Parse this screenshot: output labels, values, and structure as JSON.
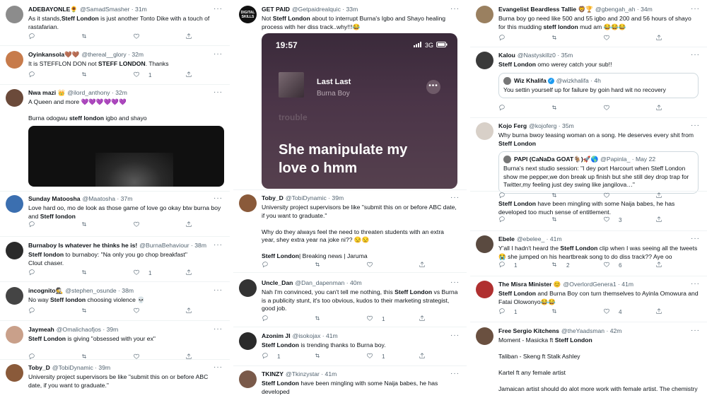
{
  "col1": [
    {
      "name": "ADEBAYONLE🌻",
      "handle": "@SamadSmasher · 31m",
      "text_html": "As it stands,<b>Steff London</b> is just another Tonto Dike with a touch of rastafarian.",
      "counts": {
        "reply": "",
        "rt": "",
        "like": ""
      },
      "avatar_color": "#8c8c8c"
    },
    {
      "name": "Oyinkansola🤎🤎",
      "handle": "@thereal__glory · 32m",
      "text_html": "It is STEFFLON DON not <b>STEFF LONDON</b>. Thanks",
      "counts": {
        "reply": "",
        "rt": "",
        "like": "1"
      },
      "avatar_color": "#c77b4b"
    },
    {
      "name": "Nwa mazi 👑",
      "handle": "@ilord_anthony · 32m",
      "text_html": "A Queen and more 💜💜💜💜💜💜\n\nBurna odogwu <b>steff london</b> igbo and shayo",
      "avatar_color": "#6b4a3a"
    },
    {
      "name": "Sunday Matoosha",
      "handle": "@Maatosha · 37m",
      "text_html": "Love hard oo, mo de look as those game of love go okay btw burna boy and <b>Steff london</b>",
      "counts": {
        "reply": "",
        "rt": "",
        "like": ""
      },
      "avatar_color": "#3b6fb0"
    },
    {
      "name": "Burnaboy Is whatever he thinks he is!",
      "handle": "@BurnaBehaviour · 38m",
      "text_html": "<b>Steff london</b> to burnaboy: \"Na only you go chop breakfast\"\nClout chaser.",
      "counts": {
        "reply": "",
        "rt": "",
        "like": "1"
      },
      "avatar_color": "#2b2b2b"
    },
    {
      "name": "incognito🕵",
      "handle": "@stephen_osunde · 38m",
      "text_html": "No way <b>Steff london</b> choosing violence 💀",
      "counts": {
        "reply": "",
        "rt": "",
        "like": ""
      },
      "avatar_color": "#444"
    },
    {
      "name": "Jaymeah",
      "handle": "@Omalichaofjos · 39m",
      "text_html": "<b>Steff London</b> is giving \"obsessed with your ex\"",
      "counts": {
        "reply": "",
        "rt": "",
        "like": ""
      },
      "avatar_color": "#c9a08a"
    },
    {
      "name": "Toby_D",
      "handle": "@TobiDynamic · 39m",
      "text_html": "University project supervisors be like \"submit this on or before ABC date, if you want to graduate.\"",
      "avatar_color": "#8a5a3a"
    }
  ],
  "col2": [
    {
      "name": "GET PAID",
      "handle": "@Getpaidrealquic · 33m",
      "text_html": "Not <b>Steff London</b> about to interrupt Burna's Igbo and Shayo healing process with her diss track..why!!!😂",
      "avatar_color": "#111",
      "avatar_text": "DIGITAL SKILLS"
    },
    {
      "name": "Toby_D",
      "handle": "@TobiDynamic · 39m",
      "text_html": "University project supervisors be like \"submit this on or before ABC date, if you want to graduate.\"\n\nWhy do they always feel the need to threaten students with an extra year, shey extra year na joke ni?? 😒😒\n\n<b>Steff London</b>| Breaking news | Jaruma",
      "counts": {
        "reply": "",
        "rt": "",
        "like": ""
      },
      "avatar_color": "#8a5a3a"
    },
    {
      "name": "Uncle_Dan",
      "handle": "@Dan_dapenman · 40m",
      "text_html": "Nah I'm convinced, you can't tell me nothing, this <b>Steff London</b> vs Burna is a publicity stunt, it's too obvious, kudos to their marketing strategist, good job.",
      "counts": {
        "reply": "",
        "rt": "",
        "like": "1"
      },
      "avatar_color": "#333"
    },
    {
      "name": "Azonim JI",
      "handle": "@isokojax · 41m",
      "text_html": "<b>Steff London</b> is trending thanks to Burna boy.",
      "counts": {
        "reply": "1",
        "rt": "",
        "like": "1"
      },
      "avatar_color": "#2a2a2a"
    },
    {
      "name": "TKINZY",
      "handle": "@Tkinzystar · 41m",
      "text_html": "<b>Steff London</b> have been mingling with some Naija babes, he has developed",
      "avatar_color": "#7a5a4a"
    }
  ],
  "phone": {
    "time": "19:57",
    "network": "3G",
    "song": "Last Last",
    "artist": "Burna Boy",
    "faded": "trouble",
    "lyric": "She manipulate my love o hmm"
  },
  "col3": [
    {
      "name": "Evangelist Beardless Tallie 🦁🏆",
      "handle": "@gbengah_ah · 34m",
      "text_html": "Burna boy go need like 500 and 55 igbo and 200 and 56 hours of shayo for this mudding <b>steff london</b> mud am 😂😂😂",
      "counts": {
        "reply": "",
        "rt": "",
        "like": ""
      },
      "avatar_color": "#9a8060"
    },
    {
      "name": "Kalou",
      "handle": "@Nastyskillz0 · 35m",
      "text_html": "<b>Steff London</b> omo werey catch your sub!!",
      "quote": {
        "name": "Wiz Khalifa",
        "handle": "@wizkhalifa · 4h",
        "verified": "✓",
        "text": "You settin yourself up for failure by goin hard wit no recovery"
      },
      "counts": {
        "reply": "",
        "rt": "",
        "like": ""
      },
      "avatar_color": "#3a3a3a"
    },
    {
      "name": "Kojo Ferg",
      "handle": "@kojoferg · 35m",
      "text_html": "Why burna bwoy teasing woman on a song. He deserves every shit from <b>Steff London</b>",
      "quote": {
        "name": "PAPI (CaNaDa GOAT🐐)🚀🌎",
        "handle": "@Papinla_ · May 22",
        "text": "Burna's next studio session: \"I dey port Harcourt when Steff London show me pepper,we don break up finish but she still dey drop trap for Twitter,my feeling just dey swing like jangilova…\""
      },
      "avatar_color": "#d8d0c8"
    },
    {
      "name": "",
      "handle": "",
      "text_html": "<b>Steff London</b> have been mingling with some Naija babes, he has developed too much sense of entitlement.",
      "counts": {
        "reply": "",
        "rt": "",
        "like": "3"
      }
    },
    {
      "name": "Ebele",
      "handle": "@ebelee_ · 41m",
      "text_html": "Y'all I hadn't heard the <b>Steff London</b> clip when I was seeing all the tweets 😭 she jumped on his heartbreak song to do diss track?? Aye oo",
      "counts": {
        "reply": "1",
        "rt": "2",
        "like": "6"
      },
      "avatar_color": "#5a4a40"
    },
    {
      "name": "The Misra Minister 😊",
      "handle": "@OverlordGenera1 · 41m",
      "text_html": "<b>Steff London</b> and Burna Boy con turn themselves to Ayinla Omowura and Fatai Olowonyo😂😂",
      "counts": {
        "reply": "1",
        "rt": "",
        "like": "4"
      },
      "avatar_color": "#b03030"
    },
    {
      "name": "Free Sergio Kitchens",
      "handle": "@theYaadsman · 42m",
      "text_html": "Moment - Masicka ft <b>Steff London</b>\n\nTaliban - Skeng ft Stalk Ashley\n\nKartel ft any female artist\n\nJamaican artist should do alot more work with female artist. The chemistry",
      "avatar_color": "#6a5040"
    }
  ],
  "colors": {
    "text": "#0f1419",
    "secondary": "#536471",
    "border": "#cfd9de",
    "verified": "#1d9bf0"
  }
}
